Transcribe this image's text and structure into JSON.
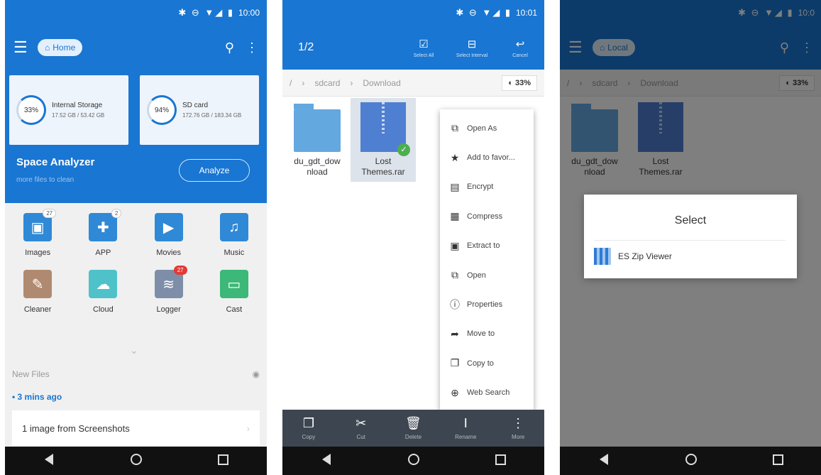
{
  "panel1": {
    "time": "10:00",
    "status_icons": "✱ ⊖ ▼◢ ▮",
    "home_label": "Home",
    "storage": [
      {
        "pct": "33%",
        "name": "Internal Storage",
        "size": "17.52 GB / 53.42 GB"
      },
      {
        "pct": "94%",
        "name": "SD card",
        "size": "172.76 GB / 183.34 GB"
      }
    ],
    "space_title": "Space Analyzer",
    "space_sub": "more files to clean",
    "analyze_label": "Analyze",
    "grid": [
      {
        "label": "Images",
        "color": "#2f89d6",
        "icon": "image-icon",
        "glyph": "▣",
        "badge": "27"
      },
      {
        "label": "APP",
        "color": "#2f89d6",
        "icon": "android-icon",
        "glyph": "✚",
        "badge": "2"
      },
      {
        "label": "Movies",
        "color": "#2f89d6",
        "icon": "play-icon",
        "glyph": "▶",
        "badge": ""
      },
      {
        "label": "Music",
        "color": "#2f89d6",
        "icon": "music-icon",
        "glyph": "♫",
        "badge": ""
      },
      {
        "label": "Cleaner",
        "color": "#b08a70",
        "icon": "broom-icon",
        "glyph": "✎",
        "badge": ""
      },
      {
        "label": "Cloud",
        "color": "#4fc1c9",
        "icon": "cloud-icon",
        "glyph": "☁",
        "badge": ""
      },
      {
        "label": "Logger",
        "color": "#7f8ea8",
        "icon": "logger-icon",
        "glyph": "≋",
        "badge": "27"
      },
      {
        "label": "Cast",
        "color": "#3cb878",
        "icon": "cast-icon",
        "glyph": "▭",
        "badge": ""
      }
    ],
    "new_files_label": "New Files",
    "time_ago": "• 3 mins ago",
    "file_card": "1 image from Screenshots"
  },
  "panel2": {
    "time": "10:01",
    "status_icons": "✱ ⊖ ▼◢ ▮",
    "count": "1/2",
    "actions": [
      {
        "label": "Select All",
        "glyph": "☑",
        "icon": "select-all-icon"
      },
      {
        "label": "Select Interval",
        "glyph": "⊟",
        "icon": "select-interval-icon"
      },
      {
        "label": "Cancel",
        "glyph": "↩",
        "icon": "cancel-icon"
      }
    ],
    "path": [
      "/",
      "sdcard",
      "Download"
    ],
    "pct": "33%",
    "files": [
      {
        "name": "du_gdt_download",
        "type": "folder"
      },
      {
        "name": "Lost Themes.rar",
        "type": "zip"
      }
    ],
    "menu": [
      {
        "label": "Open As",
        "glyph": "⧉",
        "icon": "open-as-icon"
      },
      {
        "label": "Add to favor...",
        "glyph": "★",
        "icon": "star-icon"
      },
      {
        "label": "Encrypt",
        "glyph": "▤",
        "icon": "encrypt-icon"
      },
      {
        "label": "Compress",
        "glyph": "▦",
        "icon": "compress-icon"
      },
      {
        "label": "Extract to",
        "glyph": "▣",
        "icon": "extract-icon"
      },
      {
        "label": "Open",
        "glyph": "⧉",
        "icon": "open-icon"
      },
      {
        "label": "Properties",
        "glyph": "ⓘ",
        "icon": "info-icon"
      },
      {
        "label": "Move to",
        "glyph": "➦",
        "icon": "move-icon"
      },
      {
        "label": "Copy to",
        "glyph": "❐",
        "icon": "copy-to-icon"
      },
      {
        "label": "Web Search",
        "glyph": "⊕",
        "icon": "web-search-icon"
      }
    ],
    "bottom": [
      {
        "label": "Copy",
        "glyph": "❐",
        "icon": "copy-icon"
      },
      {
        "label": "Cut",
        "glyph": "✂",
        "icon": "cut-icon"
      },
      {
        "label": "Delete",
        "glyph": "🗑",
        "icon": "delete-icon"
      },
      {
        "label": "Rename",
        "glyph": "I",
        "icon": "rename-icon"
      },
      {
        "label": "More",
        "glyph": "⋮",
        "icon": "more-icon"
      }
    ]
  },
  "panel3": {
    "time": "10:0",
    "status_icons": "✱ ⊖ ▼◢ ▮",
    "local_label": "Local",
    "path": [
      "/",
      "sdcard",
      "Download"
    ],
    "pct": "33%",
    "files": [
      "du_gdt_download",
      "Lost Themes.rar"
    ],
    "dialog_title": "Select",
    "dialog_option": "ES Zip Viewer"
  }
}
